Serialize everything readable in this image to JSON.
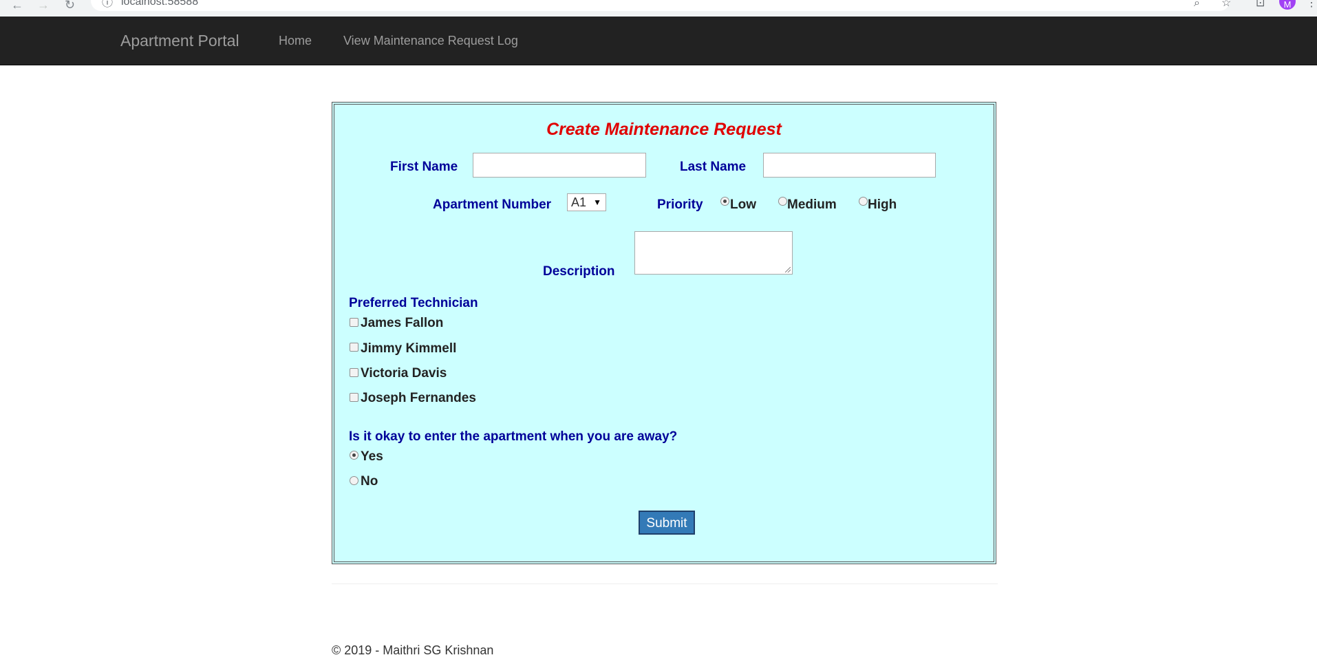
{
  "browser": {
    "url": "localhost:58588",
    "profile_initial": "M"
  },
  "navbar": {
    "brand": "Apartment Portal",
    "links": [
      "Home",
      "View Maintenance Request Log"
    ]
  },
  "form": {
    "title": "Create Maintenance Request",
    "first_name": {
      "label": "First Name",
      "value": ""
    },
    "last_name": {
      "label": "Last Name",
      "value": ""
    },
    "apartment_number": {
      "label": "Apartment Number",
      "selected": "A1"
    },
    "priority": {
      "label": "Priority",
      "options": [
        "Low",
        "Medium",
        "High"
      ],
      "selected": "Low"
    },
    "description": {
      "label": "Description",
      "value": ""
    },
    "preferred_technician": {
      "label": "Preferred Technician",
      "options": [
        "James Fallon",
        "Jimmy Kimmell",
        "Victoria Davis",
        "Joseph Fernandes"
      ]
    },
    "entry_permission": {
      "label": "Is it okay to enter the apartment when you are away?",
      "options": [
        "Yes",
        "No"
      ],
      "selected": "Yes"
    },
    "submit_label": "Submit"
  },
  "footer": {
    "text": "© 2019 - Maithri SG Krishnan"
  },
  "colors": {
    "navbar_bg": "#222222",
    "panel_bg": "#ccffff",
    "label": "#000099",
    "title": "#e00000",
    "submit_bg": "#337ab7"
  }
}
